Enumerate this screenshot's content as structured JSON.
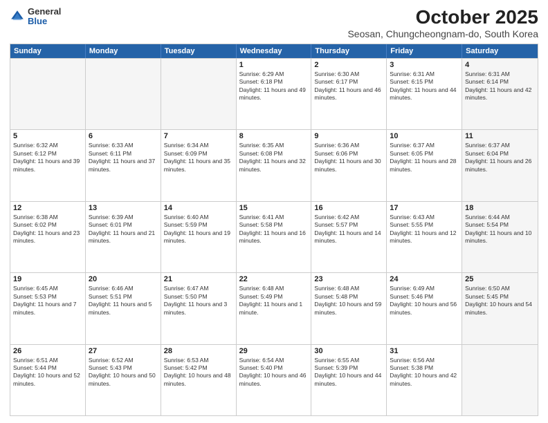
{
  "logo": {
    "general": "General",
    "blue": "Blue"
  },
  "title": "October 2025",
  "subtitle": "Seosan, Chungcheongnam-do, South Korea",
  "headers": [
    "Sunday",
    "Monday",
    "Tuesday",
    "Wednesday",
    "Thursday",
    "Friday",
    "Saturday"
  ],
  "weeks": [
    [
      {
        "day": "",
        "text": "",
        "empty": true
      },
      {
        "day": "",
        "text": "",
        "empty": true
      },
      {
        "day": "",
        "text": "",
        "empty": true
      },
      {
        "day": "1",
        "text": "Sunrise: 6:29 AM\nSunset: 6:18 PM\nDaylight: 11 hours and 49 minutes."
      },
      {
        "day": "2",
        "text": "Sunrise: 6:30 AM\nSunset: 6:17 PM\nDaylight: 11 hours and 46 minutes."
      },
      {
        "day": "3",
        "text": "Sunrise: 6:31 AM\nSunset: 6:15 PM\nDaylight: 11 hours and 44 minutes."
      },
      {
        "day": "4",
        "text": "Sunrise: 6:31 AM\nSunset: 6:14 PM\nDaylight: 11 hours and 42 minutes.",
        "shaded": true
      }
    ],
    [
      {
        "day": "5",
        "text": "Sunrise: 6:32 AM\nSunset: 6:12 PM\nDaylight: 11 hours and 39 minutes."
      },
      {
        "day": "6",
        "text": "Sunrise: 6:33 AM\nSunset: 6:11 PM\nDaylight: 11 hours and 37 minutes."
      },
      {
        "day": "7",
        "text": "Sunrise: 6:34 AM\nSunset: 6:09 PM\nDaylight: 11 hours and 35 minutes."
      },
      {
        "day": "8",
        "text": "Sunrise: 6:35 AM\nSunset: 6:08 PM\nDaylight: 11 hours and 32 minutes."
      },
      {
        "day": "9",
        "text": "Sunrise: 6:36 AM\nSunset: 6:06 PM\nDaylight: 11 hours and 30 minutes."
      },
      {
        "day": "10",
        "text": "Sunrise: 6:37 AM\nSunset: 6:05 PM\nDaylight: 11 hours and 28 minutes."
      },
      {
        "day": "11",
        "text": "Sunrise: 6:37 AM\nSunset: 6:04 PM\nDaylight: 11 hours and 26 minutes.",
        "shaded": true
      }
    ],
    [
      {
        "day": "12",
        "text": "Sunrise: 6:38 AM\nSunset: 6:02 PM\nDaylight: 11 hours and 23 minutes."
      },
      {
        "day": "13",
        "text": "Sunrise: 6:39 AM\nSunset: 6:01 PM\nDaylight: 11 hours and 21 minutes."
      },
      {
        "day": "14",
        "text": "Sunrise: 6:40 AM\nSunset: 5:59 PM\nDaylight: 11 hours and 19 minutes."
      },
      {
        "day": "15",
        "text": "Sunrise: 6:41 AM\nSunset: 5:58 PM\nDaylight: 11 hours and 16 minutes."
      },
      {
        "day": "16",
        "text": "Sunrise: 6:42 AM\nSunset: 5:57 PM\nDaylight: 11 hours and 14 minutes."
      },
      {
        "day": "17",
        "text": "Sunrise: 6:43 AM\nSunset: 5:55 PM\nDaylight: 11 hours and 12 minutes."
      },
      {
        "day": "18",
        "text": "Sunrise: 6:44 AM\nSunset: 5:54 PM\nDaylight: 11 hours and 10 minutes.",
        "shaded": true
      }
    ],
    [
      {
        "day": "19",
        "text": "Sunrise: 6:45 AM\nSunset: 5:53 PM\nDaylight: 11 hours and 7 minutes."
      },
      {
        "day": "20",
        "text": "Sunrise: 6:46 AM\nSunset: 5:51 PM\nDaylight: 11 hours and 5 minutes."
      },
      {
        "day": "21",
        "text": "Sunrise: 6:47 AM\nSunset: 5:50 PM\nDaylight: 11 hours and 3 minutes."
      },
      {
        "day": "22",
        "text": "Sunrise: 6:48 AM\nSunset: 5:49 PM\nDaylight: 11 hours and 1 minute."
      },
      {
        "day": "23",
        "text": "Sunrise: 6:48 AM\nSunset: 5:48 PM\nDaylight: 10 hours and 59 minutes."
      },
      {
        "day": "24",
        "text": "Sunrise: 6:49 AM\nSunset: 5:46 PM\nDaylight: 10 hours and 56 minutes."
      },
      {
        "day": "25",
        "text": "Sunrise: 6:50 AM\nSunset: 5:45 PM\nDaylight: 10 hours and 54 minutes.",
        "shaded": true
      }
    ],
    [
      {
        "day": "26",
        "text": "Sunrise: 6:51 AM\nSunset: 5:44 PM\nDaylight: 10 hours and 52 minutes."
      },
      {
        "day": "27",
        "text": "Sunrise: 6:52 AM\nSunset: 5:43 PM\nDaylight: 10 hours and 50 minutes."
      },
      {
        "day": "28",
        "text": "Sunrise: 6:53 AM\nSunset: 5:42 PM\nDaylight: 10 hours and 48 minutes."
      },
      {
        "day": "29",
        "text": "Sunrise: 6:54 AM\nSunset: 5:40 PM\nDaylight: 10 hours and 46 minutes."
      },
      {
        "day": "30",
        "text": "Sunrise: 6:55 AM\nSunset: 5:39 PM\nDaylight: 10 hours and 44 minutes."
      },
      {
        "day": "31",
        "text": "Sunrise: 6:56 AM\nSunset: 5:38 PM\nDaylight: 10 hours and 42 minutes."
      },
      {
        "day": "",
        "text": "",
        "empty": true,
        "shaded": true
      }
    ]
  ]
}
